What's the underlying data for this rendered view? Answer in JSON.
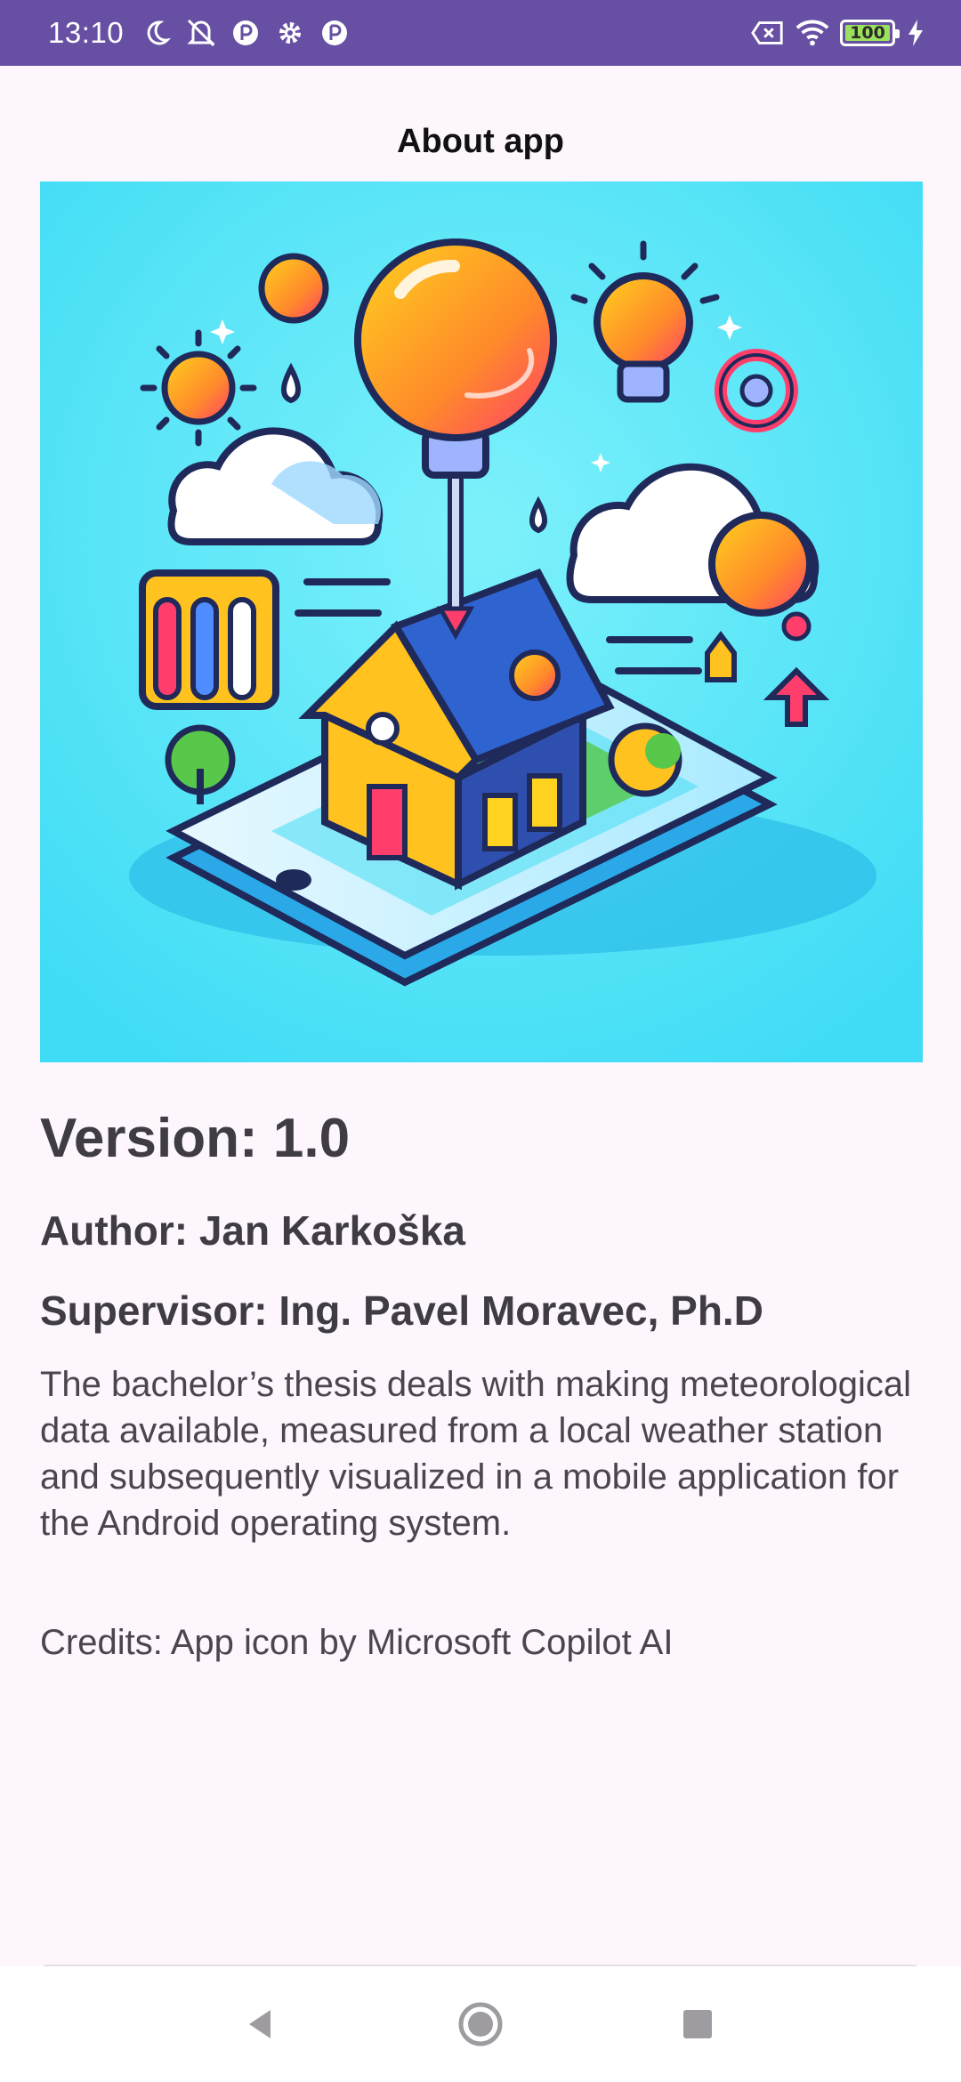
{
  "status_bar": {
    "time": "13:10",
    "battery": "100",
    "icons": [
      "moon-icon",
      "muted-vibrate-icon",
      "app-notification-icon",
      "settings-icon",
      "app-notification-icon",
      "no-sim-icon",
      "wifi-icon",
      "battery-icon",
      "charging-bolt-icon"
    ]
  },
  "header": {
    "title": "About app"
  },
  "hero": {
    "image": "app-icon-illustration"
  },
  "info": {
    "version": "Version: 1.0",
    "author": "Author: Jan Karkoška",
    "supervisor": "Supervisor: Ing. Pavel Moravec, Ph.D",
    "description": "The bachelor’s thesis deals with making meteorological data available, measured from a local weather station and subsequently visualized in a mobile application for the Android operating system.",
    "credits": "Credits: App icon by Microsoft Copilot AI"
  },
  "nav": {
    "back": "back-icon",
    "home": "home-icon",
    "recents": "recents-icon"
  },
  "colors": {
    "status_bar": "#6750a4",
    "background": "#fdf6fd",
    "hero_background": "#4ee2f7",
    "text": "#403c44"
  }
}
